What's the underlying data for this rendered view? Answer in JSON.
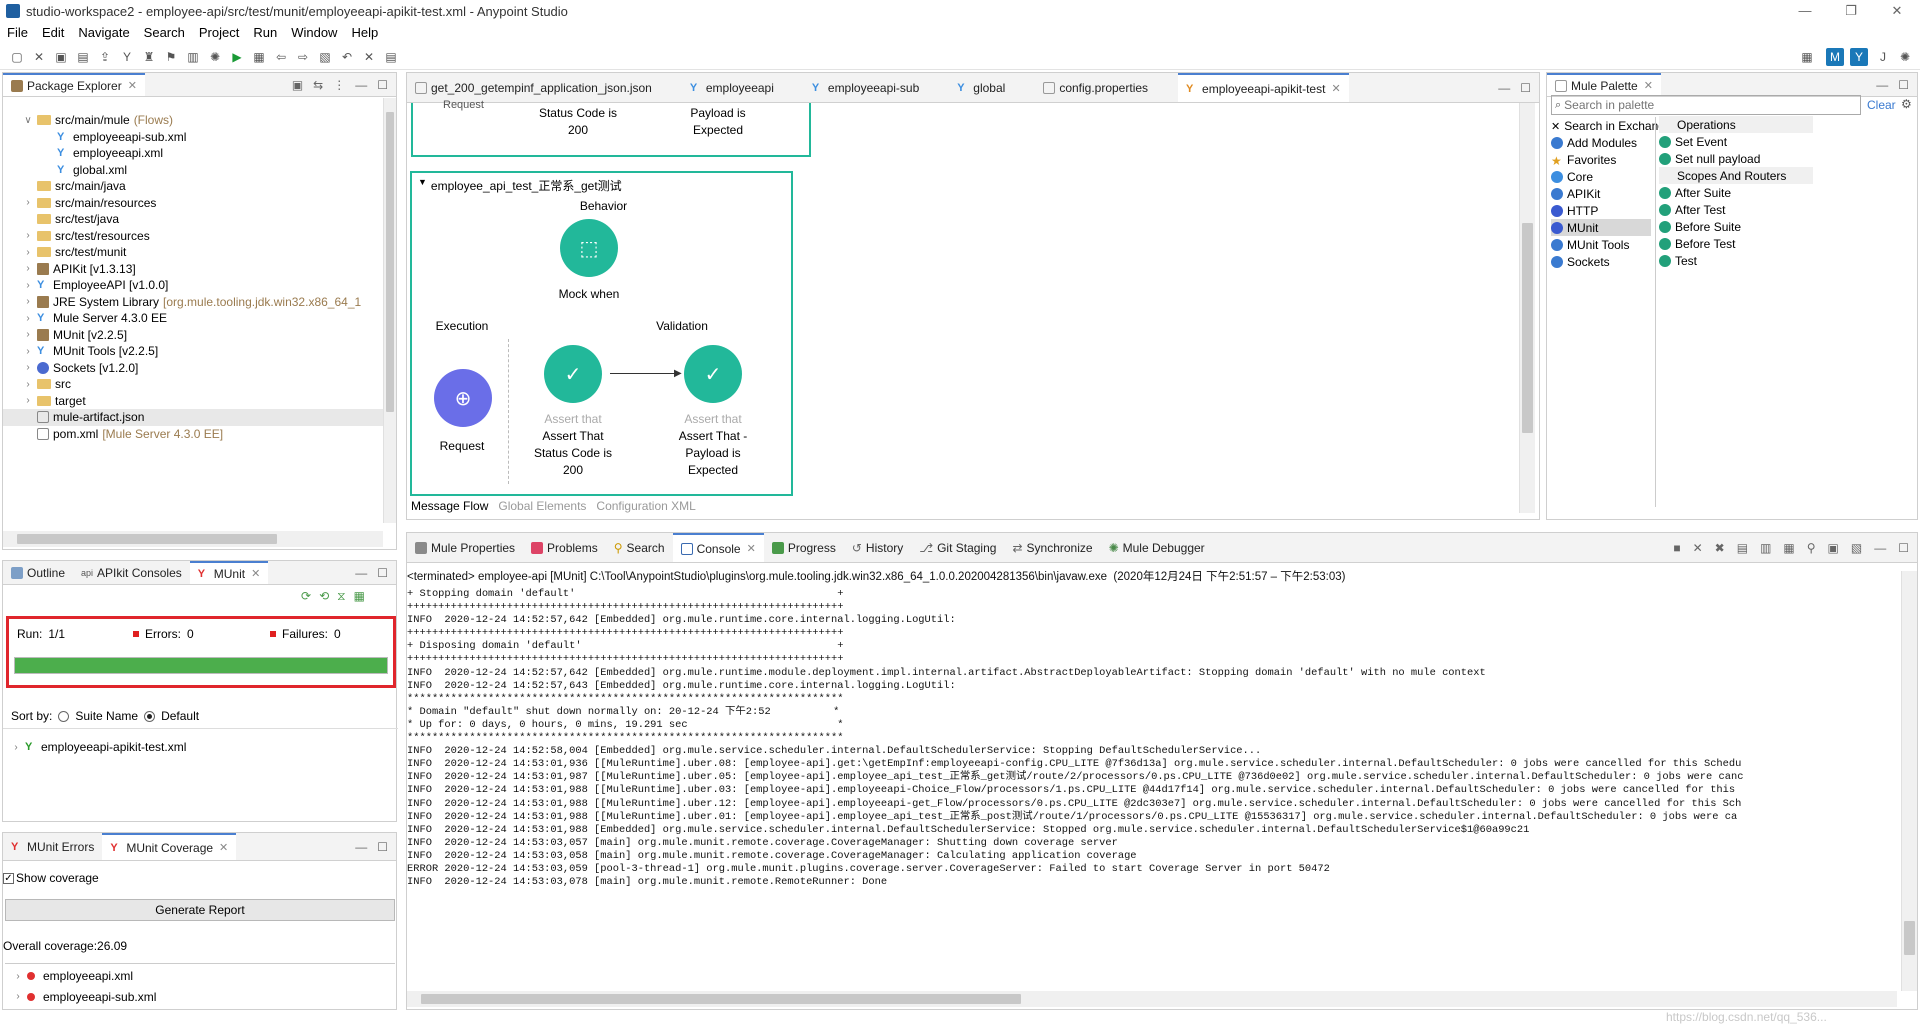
{
  "window": {
    "title": "studio-workspace2 - employee-api/src/test/munit/employeeapi-apikit-test.xml - Anypoint Studio",
    "controls": [
      "—",
      "❐",
      "✕"
    ]
  },
  "menu": [
    "File",
    "Edit",
    "Navigate",
    "Search",
    "Project",
    "Run",
    "Window",
    "Help"
  ],
  "package_explorer": {
    "tab": "Package Explorer",
    "rows": [
      {
        "label": "src/main/mule",
        "extra": " (Flows)",
        "icon": "folder",
        "indent": 1,
        "arrow": "v"
      },
      {
        "label": "employeeapi-sub.xml",
        "icon": "mule",
        "indent": 2,
        "arrow": ""
      },
      {
        "label": "employeeapi.xml",
        "icon": "mule",
        "indent": 2,
        "arrow": ""
      },
      {
        "label": "global.xml",
        "icon": "mule",
        "indent": 2,
        "arrow": ""
      },
      {
        "label": "src/main/java",
        "icon": "folder",
        "indent": 1,
        "arrow": ""
      },
      {
        "label": "src/main/resources",
        "icon": "folder",
        "indent": 1,
        "arrow": ">"
      },
      {
        "label": "src/test/java",
        "icon": "folder",
        "indent": 1,
        "arrow": ""
      },
      {
        "label": "src/test/resources",
        "icon": "folder",
        "indent": 1,
        "arrow": ">"
      },
      {
        "label": "src/test/munit",
        "icon": "folder",
        "indent": 1,
        "arrow": ">"
      },
      {
        "label": "APIKit [v1.3.13]",
        "icon": "lib",
        "indent": 1,
        "arrow": ">"
      },
      {
        "label": "EmployeeAPI [v1.0.0]",
        "icon": "mule",
        "indent": 1,
        "arrow": ">"
      },
      {
        "label": "JRE System Library",
        "extra": " [org.mule.tooling.jdk.win32.x86_64_1",
        "icon": "lib",
        "indent": 1,
        "arrow": ">"
      },
      {
        "label": "Mule Server 4.3.0 EE",
        "icon": "mule",
        "indent": 1,
        "arrow": ">"
      },
      {
        "label": "MUnit [v2.2.5]",
        "icon": "lib",
        "indent": 1,
        "arrow": ">"
      },
      {
        "label": "MUnit Tools [v2.2.5]",
        "icon": "mule",
        "indent": 1,
        "arrow": ">"
      },
      {
        "label": "Sockets [v1.2.0]",
        "icon": "circ",
        "indent": 1,
        "arrow": ">"
      },
      {
        "label": "src",
        "icon": "folder",
        "indent": 1,
        "arrow": ">"
      },
      {
        "label": "target",
        "icon": "folder",
        "indent": 1,
        "arrow": ">"
      },
      {
        "label": "mule-artifact.json",
        "icon": "file",
        "indent": 1,
        "arrow": ""
      },
      {
        "label": "pom.xml",
        "extra": " [Mule Server 4.3.0 EE]",
        "icon": "file",
        "indent": 1,
        "arrow": ""
      }
    ]
  },
  "outline_tabs": [
    "Outline",
    "APIkit Consoles",
    "MUnit"
  ],
  "munit": {
    "run_label": "Run:",
    "run_value": "1/1",
    "errors_label": "Errors:",
    "errors_value": "0",
    "failures_label": "Failures:",
    "failures_value": "0",
    "progress": 1.0,
    "sort_label": "Sort by:",
    "sort_suite": "Suite Name",
    "sort_default": "Default",
    "test_file": "employeeapi-apikit-test.xml"
  },
  "coverage": {
    "tabs": [
      "MUnit Errors",
      "MUnit Coverage"
    ],
    "show_coverage": "Show coverage",
    "generate": "Generate Report",
    "overall": "Overall coverage:26.09",
    "files": [
      "employeeapi.xml",
      "employeeapi-sub.xml"
    ]
  },
  "editor": {
    "tabs": [
      "get_200_getempinf_application_json.json",
      "employeeapi",
      "employeeapi-sub",
      "global",
      "config.properties",
      "employeeapi-apikit-test"
    ],
    "top": {
      "cut": "Request",
      "label1": "Status Code is",
      "label1b": "200",
      "label2": "Payload is",
      "label2b": "Expected"
    },
    "flow": {
      "title": "employee_api_test_正常系_get测试",
      "behavior": "Behavior",
      "mock": "Mock when",
      "execution": "Execution",
      "validation": "Validation",
      "request": "Request",
      "assert1_top": "Assert that",
      "assert1": "Assert That",
      "assert1b": "Status Code is",
      "assert1c": "200",
      "assert2_top": "Assert that",
      "assert2": "Assert That -",
      "assert2b": "Payload is",
      "assert2c": "Expected"
    },
    "bottom_tabs": [
      "Message Flow",
      "Global Elements",
      "Configuration XML"
    ]
  },
  "palette": {
    "tab": "Mule Palette",
    "search_placeholder": "Search in palette",
    "clear": "Clear",
    "left": [
      "Search in Exchange",
      "Add Modules",
      "Favorites",
      "Core",
      "APIKit",
      "HTTP",
      "MUnit",
      "MUnit Tools",
      "Sockets"
    ],
    "right": [
      {
        "label": "Operations",
        "header": true
      },
      {
        "label": "Set Event"
      },
      {
        "label": "Set null payload"
      },
      {
        "label": "Scopes And Routers",
        "header": true
      },
      {
        "label": "After Suite"
      },
      {
        "label": "After Test"
      },
      {
        "label": "Before Suite"
      },
      {
        "label": "Before Test"
      },
      {
        "label": "Test"
      }
    ]
  },
  "console": {
    "tabs": [
      "Mule Properties",
      "Problems",
      "Search",
      "Console",
      "Progress",
      "History",
      "Git Staging",
      "Synchronize",
      "Mule Debugger"
    ],
    "header": "<terminated> employee-api [MUnit] C:\\Tool\\AnypointStudio\\plugins\\org.mule.tooling.jdk.win32.x86_64_1.0.0.202004281356\\bin\\javaw.exe  (2020年12月24日 下午2:51:57 – 下午2:53:03)",
    "lines": [
      "+ Stopping domain 'default'                                          +",
      "++++++++++++++++++++++++++++++++++++++++++++++++++++++++++++++++++++++",
      "INFO  2020-12-24 14:52:57,642 [Embedded] org.mule.runtime.core.internal.logging.LogUtil:",
      "++++++++++++++++++++++++++++++++++++++++++++++++++++++++++++++++++++++",
      "+ Disposing domain 'default'                                         +",
      "++++++++++++++++++++++++++++++++++++++++++++++++++++++++++++++++++++++",
      "INFO  2020-12-24 14:52:57,642 [Embedded] org.mule.runtime.module.deployment.impl.internal.artifact.AbstractDeployableArtifact: Stopping domain 'default' with no mule context",
      "INFO  2020-12-24 14:52:57,643 [Embedded] org.mule.runtime.core.internal.logging.LogUtil:",
      "**********************************************************************",
      "* Domain \"default\" shut down normally on: 20-12-24 下午2:52          *",
      "* Up for: 0 days, 0 hours, 0 mins, 19.291 sec                        *",
      "**********************************************************************",
      "INFO  2020-12-24 14:52:58,004 [Embedded] org.mule.service.scheduler.internal.DefaultSchedulerService: Stopping DefaultSchedulerService...",
      "INFO  2020-12-24 14:53:01,936 [[MuleRuntime].uber.08: [employee-api].get:\\getEmpInf:employeeapi-config.CPU_LITE @7f36d13a] org.mule.service.scheduler.internal.DefaultScheduler: 0 jobs were cancelled for this Schedu",
      "INFO  2020-12-24 14:53:01,987 [[MuleRuntime].uber.05: [employee-api].employee_api_test_正常系_get测试/route/2/processors/0.ps.CPU_LITE @736d0e02] org.mule.service.scheduler.internal.DefaultScheduler: 0 jobs were canc",
      "INFO  2020-12-24 14:53:01,988 [[MuleRuntime].uber.03: [employee-api].employeeapi-Choice_Flow/processors/1.ps.CPU_LITE @44d17f14] org.mule.service.scheduler.internal.DefaultScheduler: 0 jobs were cancelled for this",
      "INFO  2020-12-24 14:53:01,988 [[MuleRuntime].uber.12: [employee-api].employeeapi-get_Flow/processors/0.ps.CPU_LITE @2dc303e7] org.mule.service.scheduler.internal.DefaultScheduler: 0 jobs were cancelled for this Sch",
      "INFO  2020-12-24 14:53:01,988 [[MuleRuntime].uber.01: [employee-api].employee_api_test_正常系_post测试/route/1/processors/0.ps.CPU_LITE @15536317] org.mule.service.scheduler.internal.DefaultScheduler: 0 jobs were ca",
      "INFO  2020-12-24 14:53:01,988 [Embedded] org.mule.service.scheduler.internal.DefaultSchedulerService: Stopped org.mule.service.scheduler.internal.DefaultSchedulerService$1@60a99c21",
      "INFO  2020-12-24 14:53:03,057 [main] org.mule.munit.remote.coverage.CoverageManager: Shutting down coverage server",
      "INFO  2020-12-24 14:53:03,058 [main] org.mule.munit.remote.coverage.CoverageManager: Calculating application coverage",
      "ERROR 2020-12-24 14:53:03,059 [pool-3-thread-1] org.mule.munit.plugins.coverage.server.CoverageServer: Failed to start Coverage Server in port 50472",
      "INFO  2020-12-24 14:53:03,078 [main] org.mule.munit.remote.RemoteRunner: Done"
    ]
  },
  "watermark": "https://blog.csdn.net/qq_536...",
  "colors": {
    "accent": "#4a7fd0",
    "green": "#22b89a",
    "munit_bar": "#4cae4c",
    "highlight_box": "#e0262c",
    "request": "#6a6ee8"
  }
}
